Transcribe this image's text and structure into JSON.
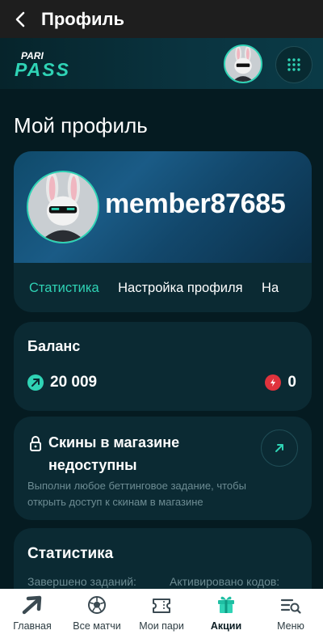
{
  "header": {
    "title": "Профиль"
  },
  "brand": {
    "logo_top": "PARI",
    "logo_bottom": "PASS"
  },
  "page": {
    "title": "Мой профиль"
  },
  "profile": {
    "username": "member87685",
    "tabs": [
      {
        "label": "Статистика",
        "active": true
      },
      {
        "label": "Настройка профиля",
        "active": false
      },
      {
        "label": "На",
        "active": false
      }
    ]
  },
  "balance": {
    "title": "Баланс",
    "coins": "20 009",
    "tokens": "0"
  },
  "skins": {
    "title": "Скины в магазине недоступны",
    "subtitle": "Выполни любое беттинговое задание, чтобы открыть доступ к скинам в магазине"
  },
  "stats": {
    "title": "Статистика",
    "completed_label": "Завершено заданий:",
    "codes_label": "Активировано кодов:"
  },
  "nav": {
    "items": [
      {
        "label": "Главная",
        "icon": "arrow-up-right-icon"
      },
      {
        "label": "Все матчи",
        "icon": "soccer-ball-icon"
      },
      {
        "label": "Мои пари",
        "icon": "ticket-icon"
      },
      {
        "label": "Акции",
        "icon": "gift-icon",
        "active": true
      },
      {
        "label": "Меню",
        "icon": "menu-search-icon"
      }
    ]
  },
  "colors": {
    "accent": "#2fd3b5",
    "background": "#051a20",
    "card": "#0b2a33",
    "danger": "#e0333d"
  }
}
